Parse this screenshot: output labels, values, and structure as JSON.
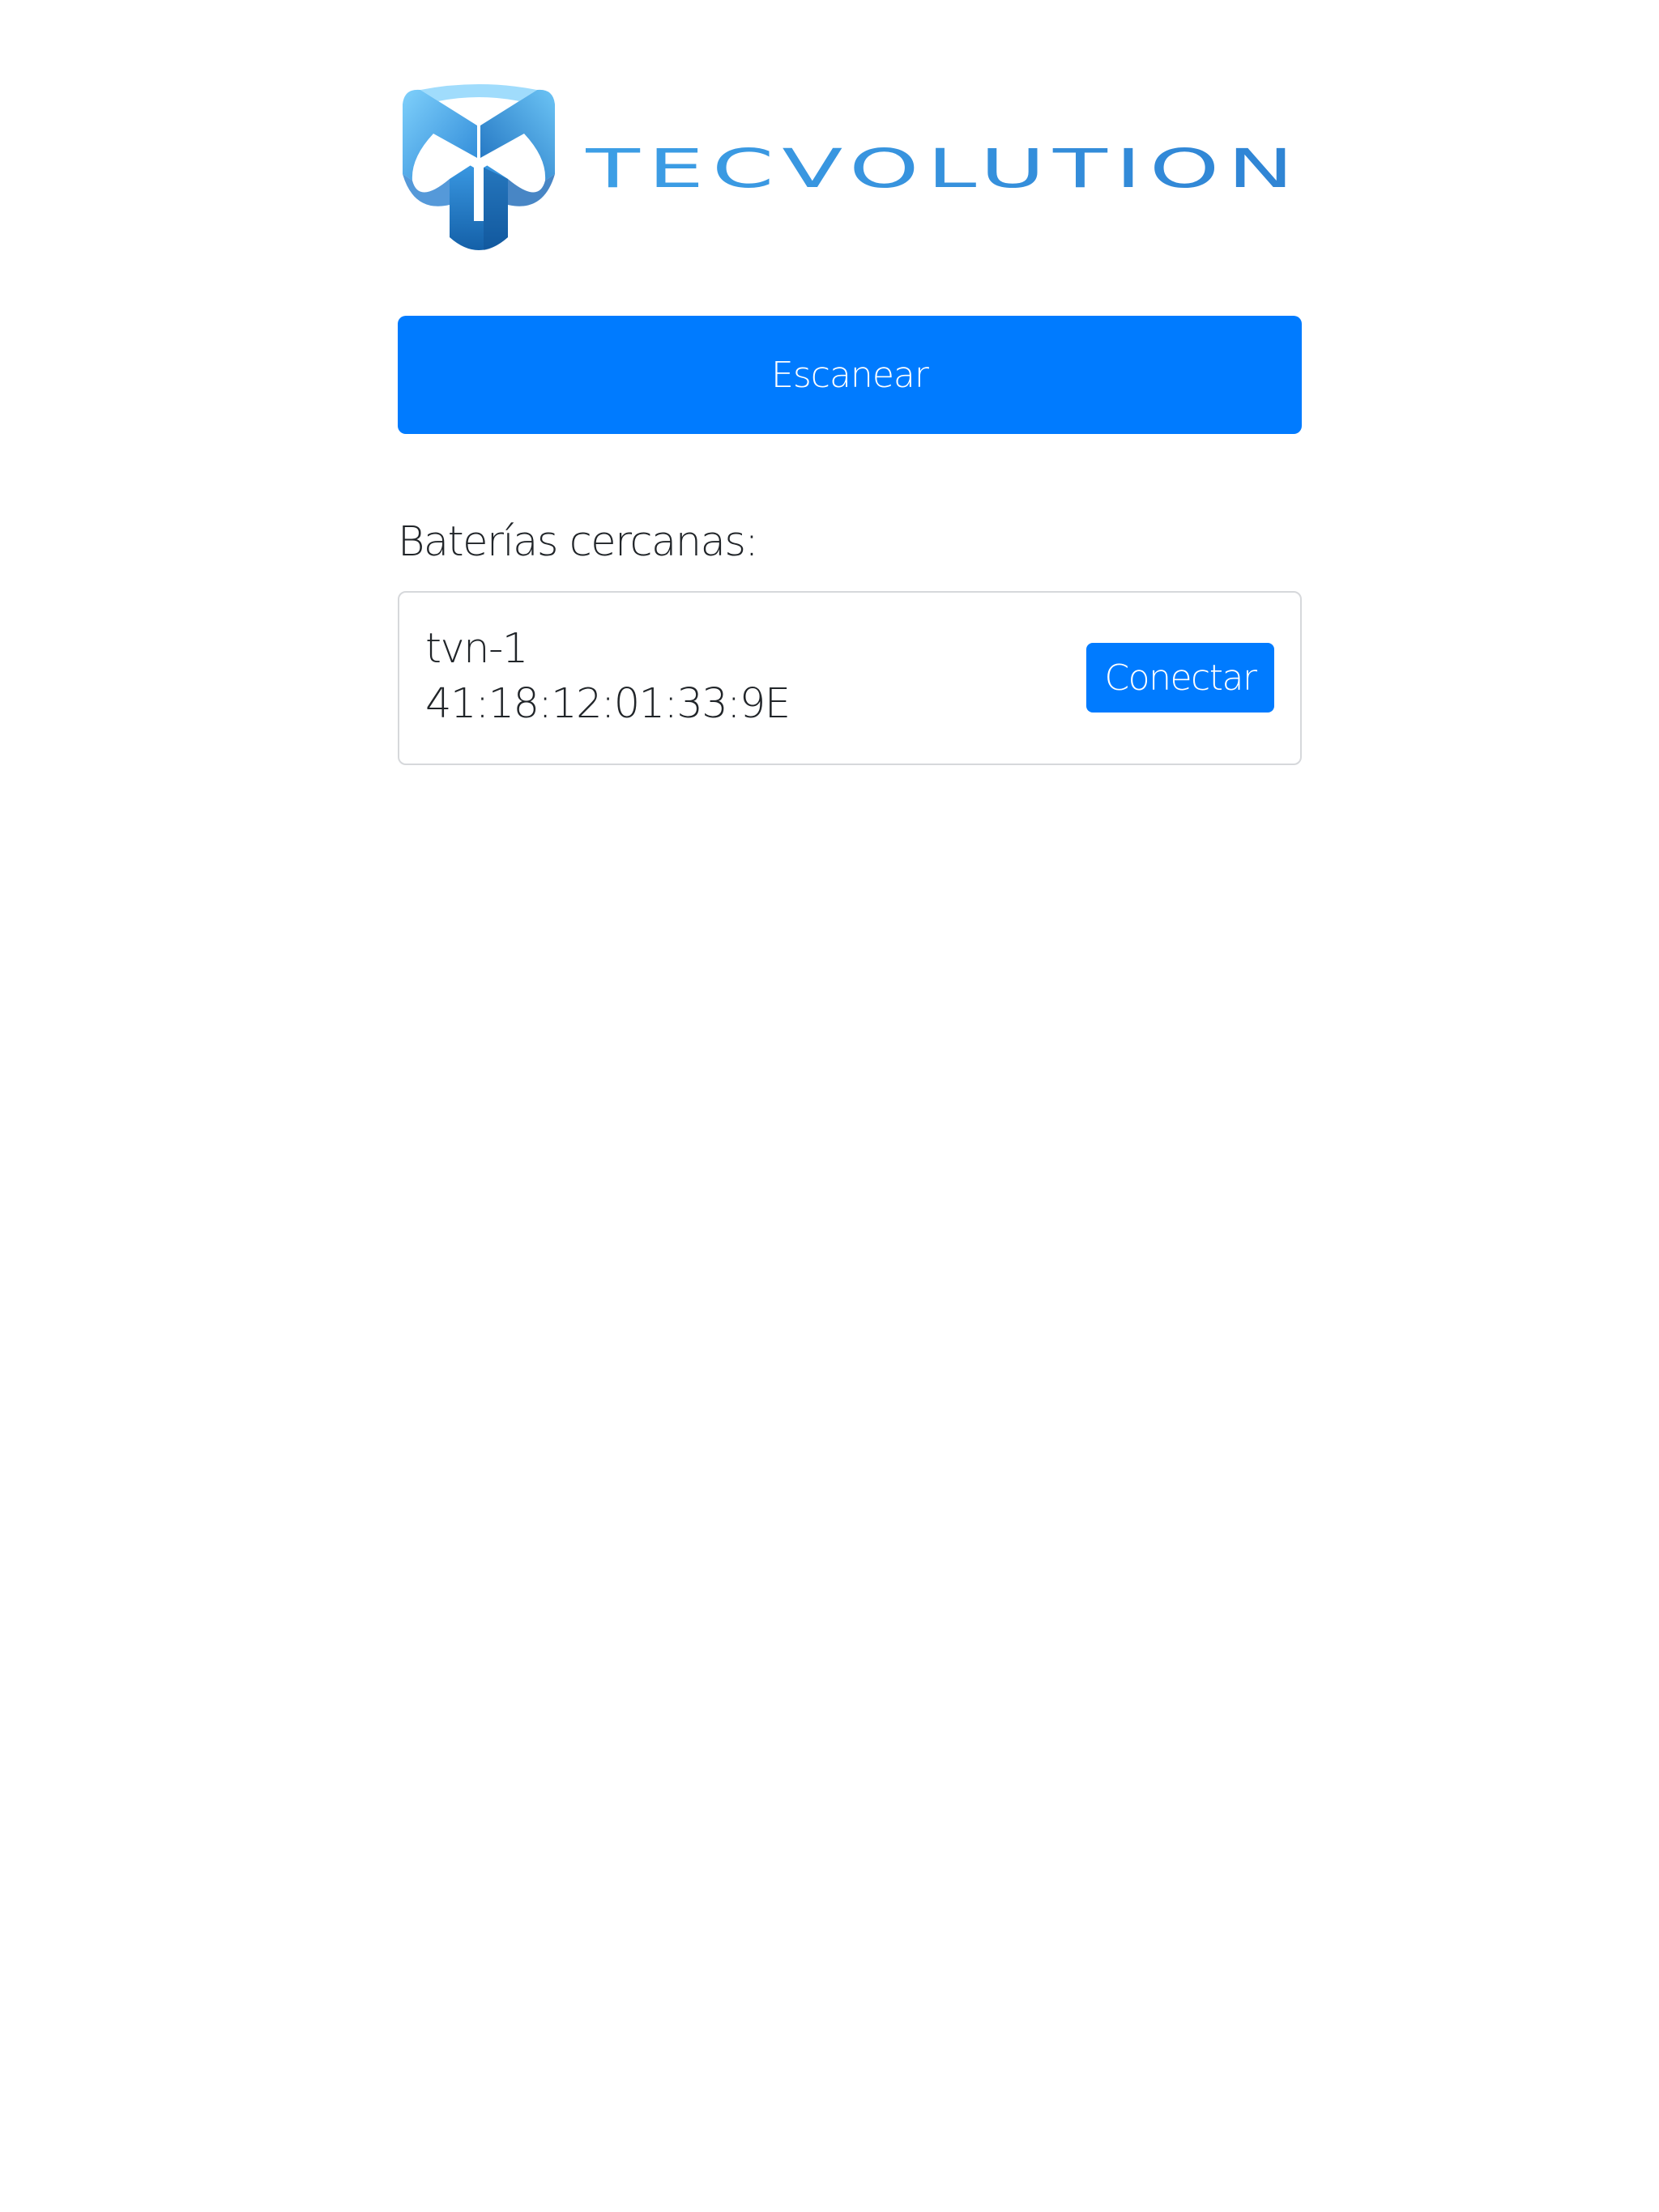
{
  "brand": {
    "name": "TECVOLUTION",
    "logo_icon": "tecvolution-cube-logo",
    "colors": {
      "light": "#5bb8f0",
      "mid": "#2f8fdb",
      "dark": "#1866b0"
    }
  },
  "scan": {
    "label": "Escanear"
  },
  "devices": {
    "heading": "Baterías cercanas:",
    "items": [
      {
        "name": "tvn-1",
        "address": "41:18:12:01:33:9E",
        "action_label": "Conectar"
      }
    ]
  },
  "theme": {
    "primary": "#007bff",
    "text": "#212529",
    "border": "#d6d8db",
    "background": "#ffffff"
  }
}
